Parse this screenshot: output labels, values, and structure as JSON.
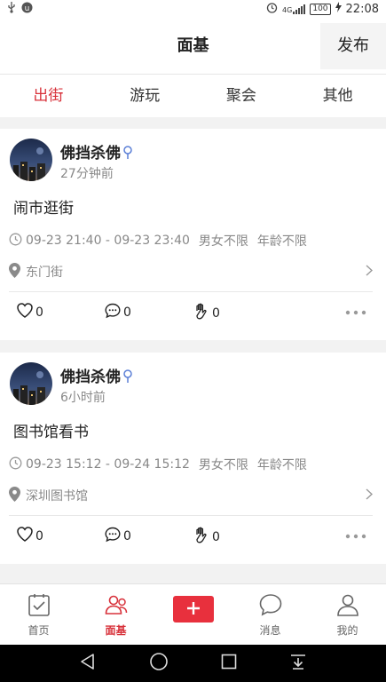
{
  "status_bar": {
    "time": "22:08",
    "battery": "100",
    "network": "4G"
  },
  "header": {
    "title": "面基",
    "publish_label": "发布"
  },
  "tabs": [
    {
      "label": "出街",
      "active": true
    },
    {
      "label": "游玩",
      "active": false
    },
    {
      "label": "聚会",
      "active": false
    },
    {
      "label": "其他",
      "active": false
    }
  ],
  "posts": [
    {
      "user_name": "佛挡杀佛",
      "time_ago": "27分钟前",
      "title": "闹市逛街",
      "time_range": "09-23 21:40 - 09-23 23:40",
      "gender_limit": "男女不限",
      "age_limit": "年龄不限",
      "location": "东门街",
      "likes": "0",
      "comments": "0",
      "claps": "0"
    },
    {
      "user_name": "佛挡杀佛",
      "time_ago": "6小时前",
      "title": "图书馆看书",
      "time_range": "09-23 15:12 - 09-24 15:12",
      "gender_limit": "男女不限",
      "age_limit": "年龄不限",
      "location": "深圳图书馆",
      "likes": "0",
      "comments": "0",
      "claps": "0"
    }
  ],
  "bottom_nav": [
    {
      "label": "首页",
      "icon": "checklist-icon"
    },
    {
      "label": "面基",
      "icon": "people-icon",
      "active": true
    },
    {
      "label": "",
      "icon": "plus-icon"
    },
    {
      "label": "消息",
      "icon": "chat-bubble-icon"
    },
    {
      "label": "我的",
      "icon": "user-icon"
    }
  ],
  "colors": {
    "accent": "#d8323b",
    "plus_button": "#e8303d",
    "gender_male": "#5b7fd6"
  }
}
